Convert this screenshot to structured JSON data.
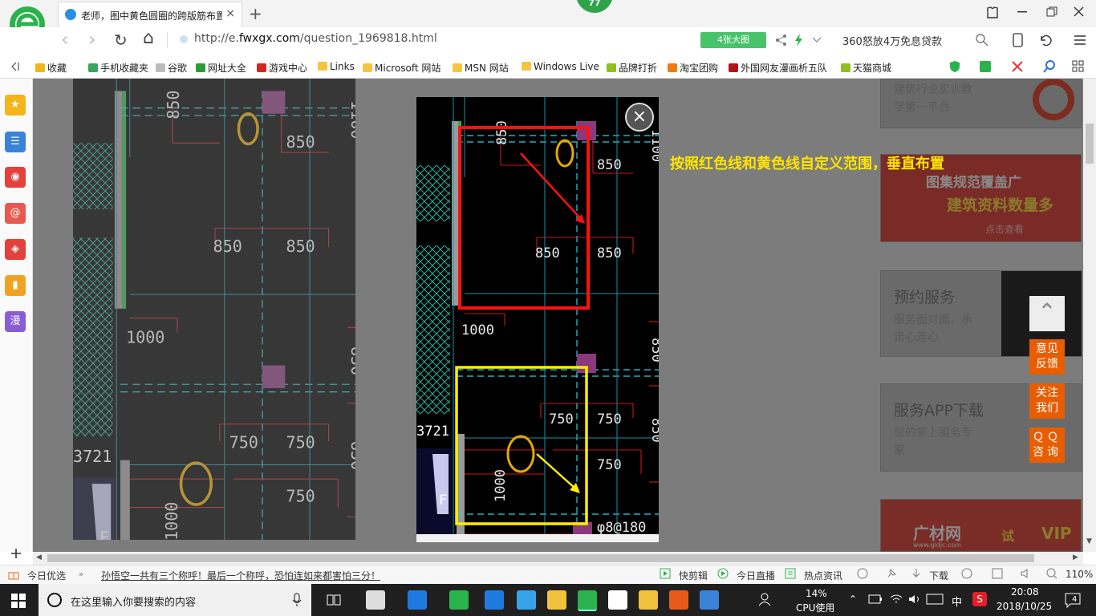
{
  "browser": {
    "tab_title": "老师，图中黄色圆圈的跨版筋布置",
    "tab_close": "×",
    "new_tab": "+",
    "badge_count": "77",
    "url_prefix": "http://e.",
    "url_domain": "fwxgx.com",
    "url_path": "/question_1969818.html",
    "big_pic_label": "4张大图",
    "ad_text": "360怒放4万免息贷款",
    "back": "‹",
    "forward": "›",
    "refresh": "↻",
    "home": "⌂"
  },
  "bookmarks": [
    {
      "label": "收藏",
      "color": "#f3b51b"
    },
    {
      "label": "手机收藏夹",
      "color": "#3aa55a"
    },
    {
      "label": "谷歌",
      "color": "#bbbbbb"
    },
    {
      "label": "网址大全",
      "color": "#2e9b3a"
    },
    {
      "label": "游戏中心",
      "color": "#d0281f"
    },
    {
      "label": "Links",
      "color": "#f5c542"
    },
    {
      "label": "Microsoft 网站",
      "color": "#f5c542"
    },
    {
      "label": "MSN 网站",
      "color": "#f5c542"
    },
    {
      "label": "Windows Live",
      "color": "#f5c542"
    },
    {
      "label": "品牌打折",
      "color": "#8fbf21"
    },
    {
      "label": "淘宝团购",
      "color": "#f07a12"
    },
    {
      "label": "外国网友漫画析五队",
      "color": "#b3131b"
    },
    {
      "label": "天猫商城",
      "color": "#8fbf21"
    }
  ],
  "sidebar_icons": [
    {
      "name": "favorites-star-icon",
      "color": "#f3b51b",
      "glyph": "★"
    },
    {
      "name": "news-icon",
      "color": "#3a83d6",
      "glyph": "☰"
    },
    {
      "name": "weibo-icon",
      "color": "#e3413c",
      "glyph": "◉"
    },
    {
      "name": "mail-icon",
      "color": "#e85a4f",
      "glyph": "@"
    },
    {
      "name": "game-icon",
      "color": "#e3413c",
      "glyph": "◈"
    },
    {
      "name": "notes-icon",
      "color": "#f0a322",
      "glyph": "▮"
    },
    {
      "name": "comic-icon",
      "color": "#8a5cd6",
      "glyph": "漫"
    }
  ],
  "viewer": {
    "close": "×",
    "annotation": "按照红色线和黄色线自定义范围，垂直布置"
  },
  "cad_labels": {
    "main": [
      "850",
      "850",
      "850",
      "850",
      "1000",
      "750",
      "750",
      "750",
      "1000",
      "F",
      "3721",
      "φ8@180",
      "1100",
      "850",
      "850"
    ],
    "left": [
      "850",
      "850",
      "850",
      "850",
      "1000",
      "750",
      "750",
      "750",
      "1000",
      "F",
      "3721",
      "φ8@180",
      "1100",
      "850",
      "850"
    ]
  },
  "right_panel": {
    "top_card_text1": "建筑行业实训教",
    "top_card_text2": "学第一平台",
    "banner_line1": "图集规范覆盖广",
    "banner_line2": "建筑资料数量多",
    "banner_link": "点击查看",
    "service_title": "预约服务",
    "service_desc1": "服务面对面，承",
    "service_desc2": "诺心连心",
    "app_title": "服务APP下载",
    "app_desc1": "您的掌上服务专",
    "app_desc2": "家",
    "ad_brand": "广材网",
    "ad_url": "www.gldjc.com",
    "ad_try": "试",
    "ad_vip": "VIP"
  },
  "float_buttons": [
    {
      "name": "back-to-top-button",
      "label": "⌃"
    },
    {
      "name": "feedback-button",
      "label": "意见反馈"
    },
    {
      "name": "follow-button",
      "label": "关注我们"
    },
    {
      "name": "qq-consult-button",
      "label": "ＱＱ咨询"
    }
  ],
  "statusbar": {
    "today": "今日优选",
    "news": "孙悟空一共有三个称呼！最后一个称呼，恐怕连如来都害怕三分！",
    "kuaijian": "快剪辑",
    "live": "今日直播",
    "hotnews": "热点资讯",
    "download": "下载",
    "zoom": "110%"
  },
  "taskbar": {
    "search_placeholder": "在这里输入你要搜索的内容",
    "cpu": "14%",
    "cpu_label": "CPU使用",
    "ime": "中",
    "time": "20:08",
    "date": "2018/10/25",
    "notifications": "4"
  }
}
